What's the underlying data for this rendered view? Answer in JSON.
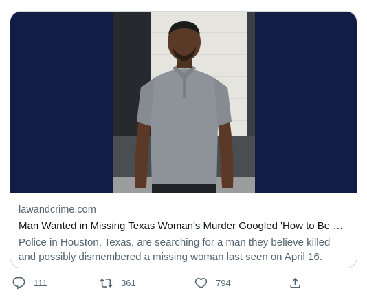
{
  "card": {
    "domain": "lawandcrime.com",
    "title": "Man Wanted in Missing Texas Woman's Murder Googled 'How to Be a ...",
    "description": "Police in Houston, Texas, are searching for a man they believe killed and possibly dismembered a missing woman last seen on April 16.",
    "image_background_color": "#121c44"
  },
  "actions": {
    "reply": {
      "icon": "reply-icon",
      "count": "111"
    },
    "retweet": {
      "icon": "retweet-icon",
      "count": "361"
    },
    "like": {
      "icon": "heart-icon",
      "count": "794"
    },
    "share": {
      "icon": "share-icon"
    }
  },
  "colors": {
    "muted": "#536471",
    "border": "#cfd9de",
    "text": "#0f1419"
  }
}
